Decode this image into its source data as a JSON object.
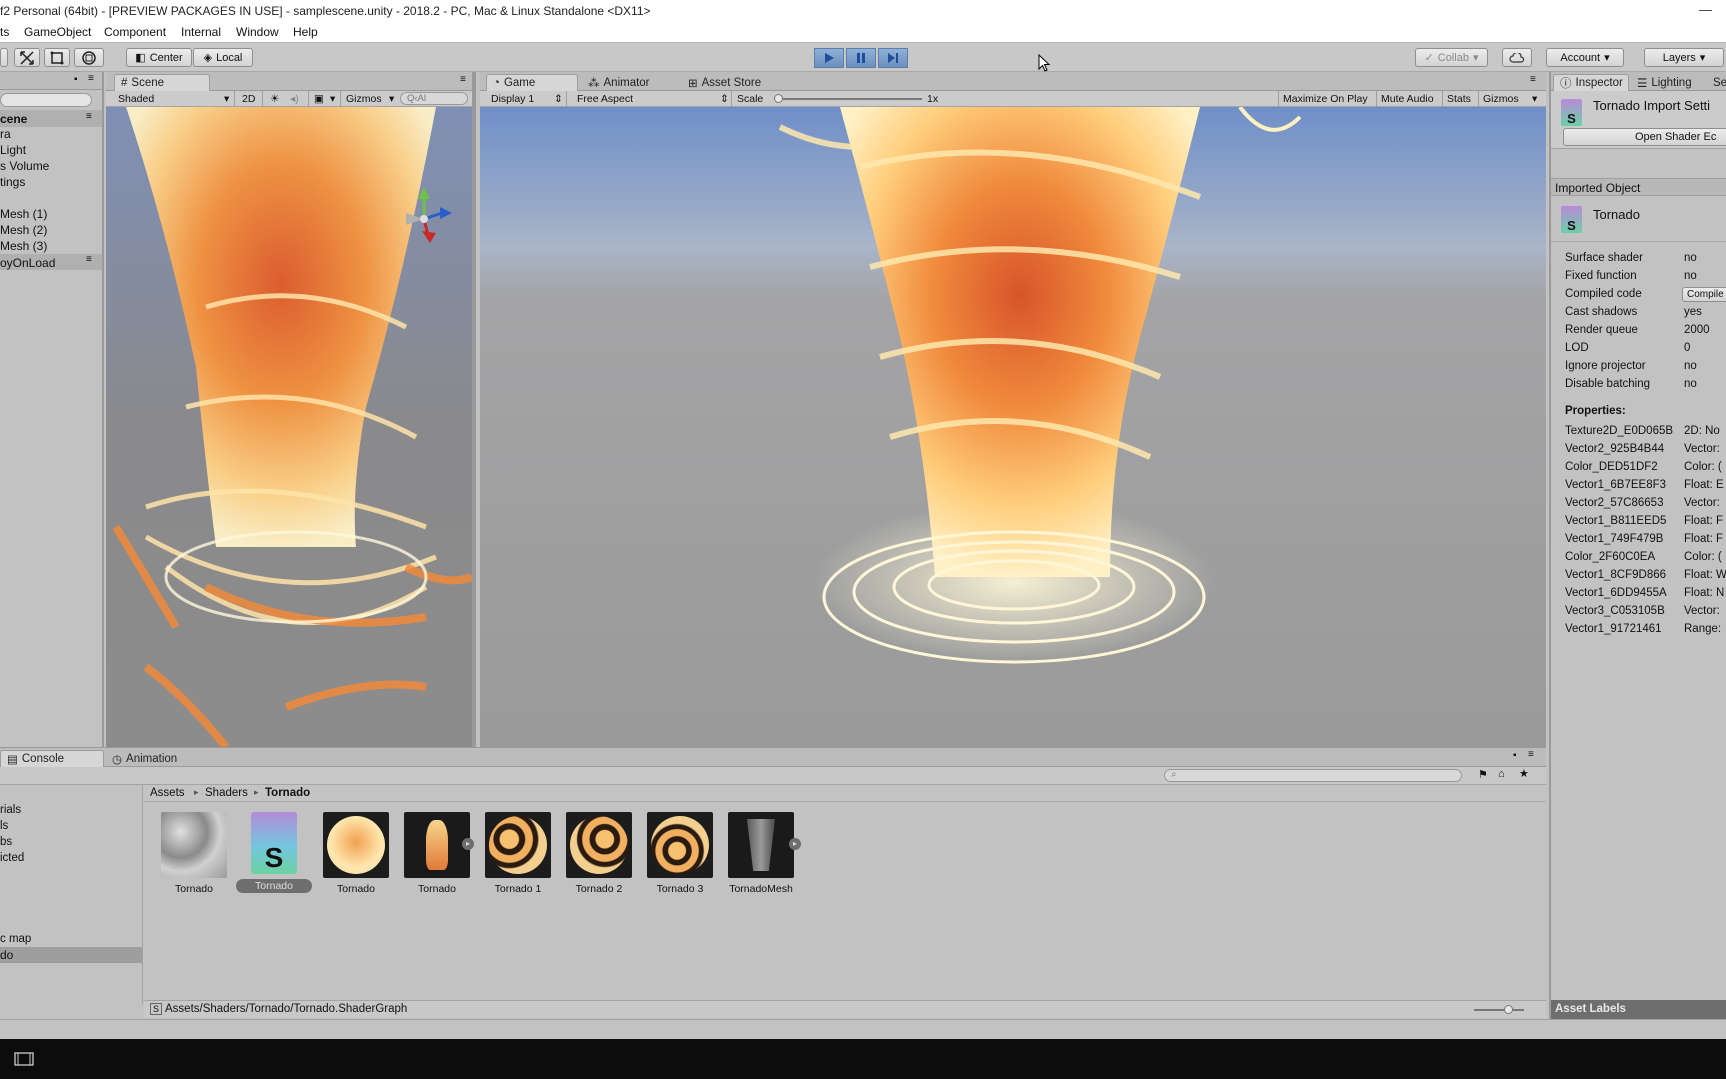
{
  "window": {
    "title": "f2 Personal (64bit) - [PREVIEW PACKAGES IN USE] - samplescene.unity - 2018.2 - PC, Mac & Linux Standalone <DX11>",
    "minimize": "—"
  },
  "menu": [
    "ts",
    "GameObject",
    "Component",
    "Internal",
    "Window",
    "Help"
  ],
  "toolbar": {
    "center": "Center",
    "local": "Local",
    "collab": "Collab",
    "account": "Account",
    "layers": "Layers"
  },
  "hierarchy": {
    "scene": "cene",
    "items": [
      "ra",
      "Light",
      "s Volume",
      "tings",
      "Mesh (1)",
      "Mesh (2)",
      "Mesh (3)",
      "oyOnLoad"
    ]
  },
  "scene_view": {
    "tab": "Scene",
    "shading": "Shaded",
    "mode_2d": "2D",
    "gizmos": "Gizmos",
    "search": "Q‹Al"
  },
  "game_view": {
    "tabs": [
      "Game",
      "Animator",
      "Asset Store"
    ],
    "display": "Display 1",
    "aspect": "Free Aspect",
    "scale_label": "Scale",
    "scale_value": "1x",
    "scale_level": 0.0,
    "maximize": "Maximize On Play",
    "mute": "Mute Audio",
    "stats": "Stats",
    "gizmos": "Gizmos"
  },
  "inspector": {
    "tabs": [
      "Inspector",
      "Lighting",
      "Se"
    ],
    "header_title": "Tornado Import Setti",
    "open_shader": "Open Shader Ec",
    "imported_object": "Imported Object",
    "object_name": "Tornado",
    "fields": [
      {
        "label": "Surface shader",
        "value": "no"
      },
      {
        "label": "Fixed function",
        "value": "no"
      },
      {
        "label": "Compiled code",
        "value": "Compile"
      },
      {
        "label": "Cast shadows",
        "value": "yes"
      },
      {
        "label": "Render queue",
        "value": "2000"
      },
      {
        "label": "LOD",
        "value": "0"
      },
      {
        "label": "Ignore projector",
        "value": "no"
      },
      {
        "label": "Disable batching",
        "value": "no"
      }
    ],
    "properties_title": "Properties:",
    "properties": [
      {
        "name": "Texture2D_E0D065B",
        "type": "2D: No"
      },
      {
        "name": "Vector2_925B4B44",
        "type": "Vector:"
      },
      {
        "name": "Color_DED51DF2",
        "type": "Color: ("
      },
      {
        "name": "Vector1_6B7EE8F3",
        "type": "Float: E"
      },
      {
        "name": "Vector2_57C86653",
        "type": "Vector:"
      },
      {
        "name": "Vector1_B811EED5",
        "type": "Float: F"
      },
      {
        "name": "Vector1_749F479B",
        "type": "Float: F"
      },
      {
        "name": "Color_2F60C0EA",
        "type": "Color: ("
      },
      {
        "name": "Vector1_8CF9D866",
        "type": "Float: W"
      },
      {
        "name": "Vector1_6DD9455A",
        "type": "Float: N"
      },
      {
        "name": "Vector3_C053105B",
        "type": "Vector:"
      },
      {
        "name": "Vector1_91721461",
        "type": "Range:"
      }
    ],
    "asset_labels": "Asset Labels"
  },
  "bottom": {
    "tabs": [
      "Console",
      "Animation"
    ],
    "left_items": [
      "rials",
      "ls",
      "bs",
      "icted",
      "c map",
      "do"
    ],
    "breadcrumb": [
      "Assets",
      "Shaders",
      "Tornado"
    ],
    "assets": [
      {
        "label": "Tornado",
        "kind": "noise",
        "selected": false
      },
      {
        "label": "Tornado",
        "kind": "shader",
        "selected": true
      },
      {
        "label": "Tornado",
        "kind": "material",
        "selected": false
      },
      {
        "label": "Tornado",
        "kind": "prefab",
        "selected": false
      },
      {
        "label": "Tornado 1",
        "kind": "material-dark",
        "selected": false
      },
      {
        "label": "Tornado 2",
        "kind": "material-dark",
        "selected": false
      },
      {
        "label": "Tornado 3",
        "kind": "material-dark",
        "selected": false
      },
      {
        "label": "TornadoMesh",
        "kind": "mesh",
        "selected": false
      }
    ],
    "path": "Assets/Shaders/Tornado/Tornado.ShaderGraph"
  },
  "colors": {
    "play_blue": "#6b8fbf",
    "fire_orange": "#f08a3c",
    "fire_yellow": "#ffe9a6",
    "sky_blue": "#8fa9d6"
  }
}
